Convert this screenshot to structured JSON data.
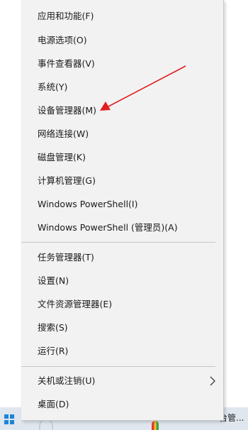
{
  "menu": {
    "items": [
      {
        "label": "应用和功能(F)"
      },
      {
        "label": "电源选项(O)"
      },
      {
        "label": "事件查看器(V)"
      },
      {
        "label": "系统(Y)"
      },
      {
        "label": "设备管理器(M)"
      },
      {
        "label": "网络连接(W)"
      },
      {
        "label": "磁盘管理(K)"
      },
      {
        "label": "计算机管理(G)"
      },
      {
        "label": "Windows PowerShell(I)"
      },
      {
        "label": "Windows PowerShell (管理员)(A)"
      },
      {
        "label": "任务管理器(T)"
      },
      {
        "label": "设置(N)"
      },
      {
        "label": "文件资源管理器(E)"
      },
      {
        "label": "搜索(S)"
      },
      {
        "label": "运行(R)"
      },
      {
        "label": "关机或注销(U)"
      },
      {
        "label": "桌面(D)"
      }
    ]
  },
  "annotation": {
    "color": "#e02020"
  },
  "taskbar": {
    "partial_label": "台管..."
  }
}
